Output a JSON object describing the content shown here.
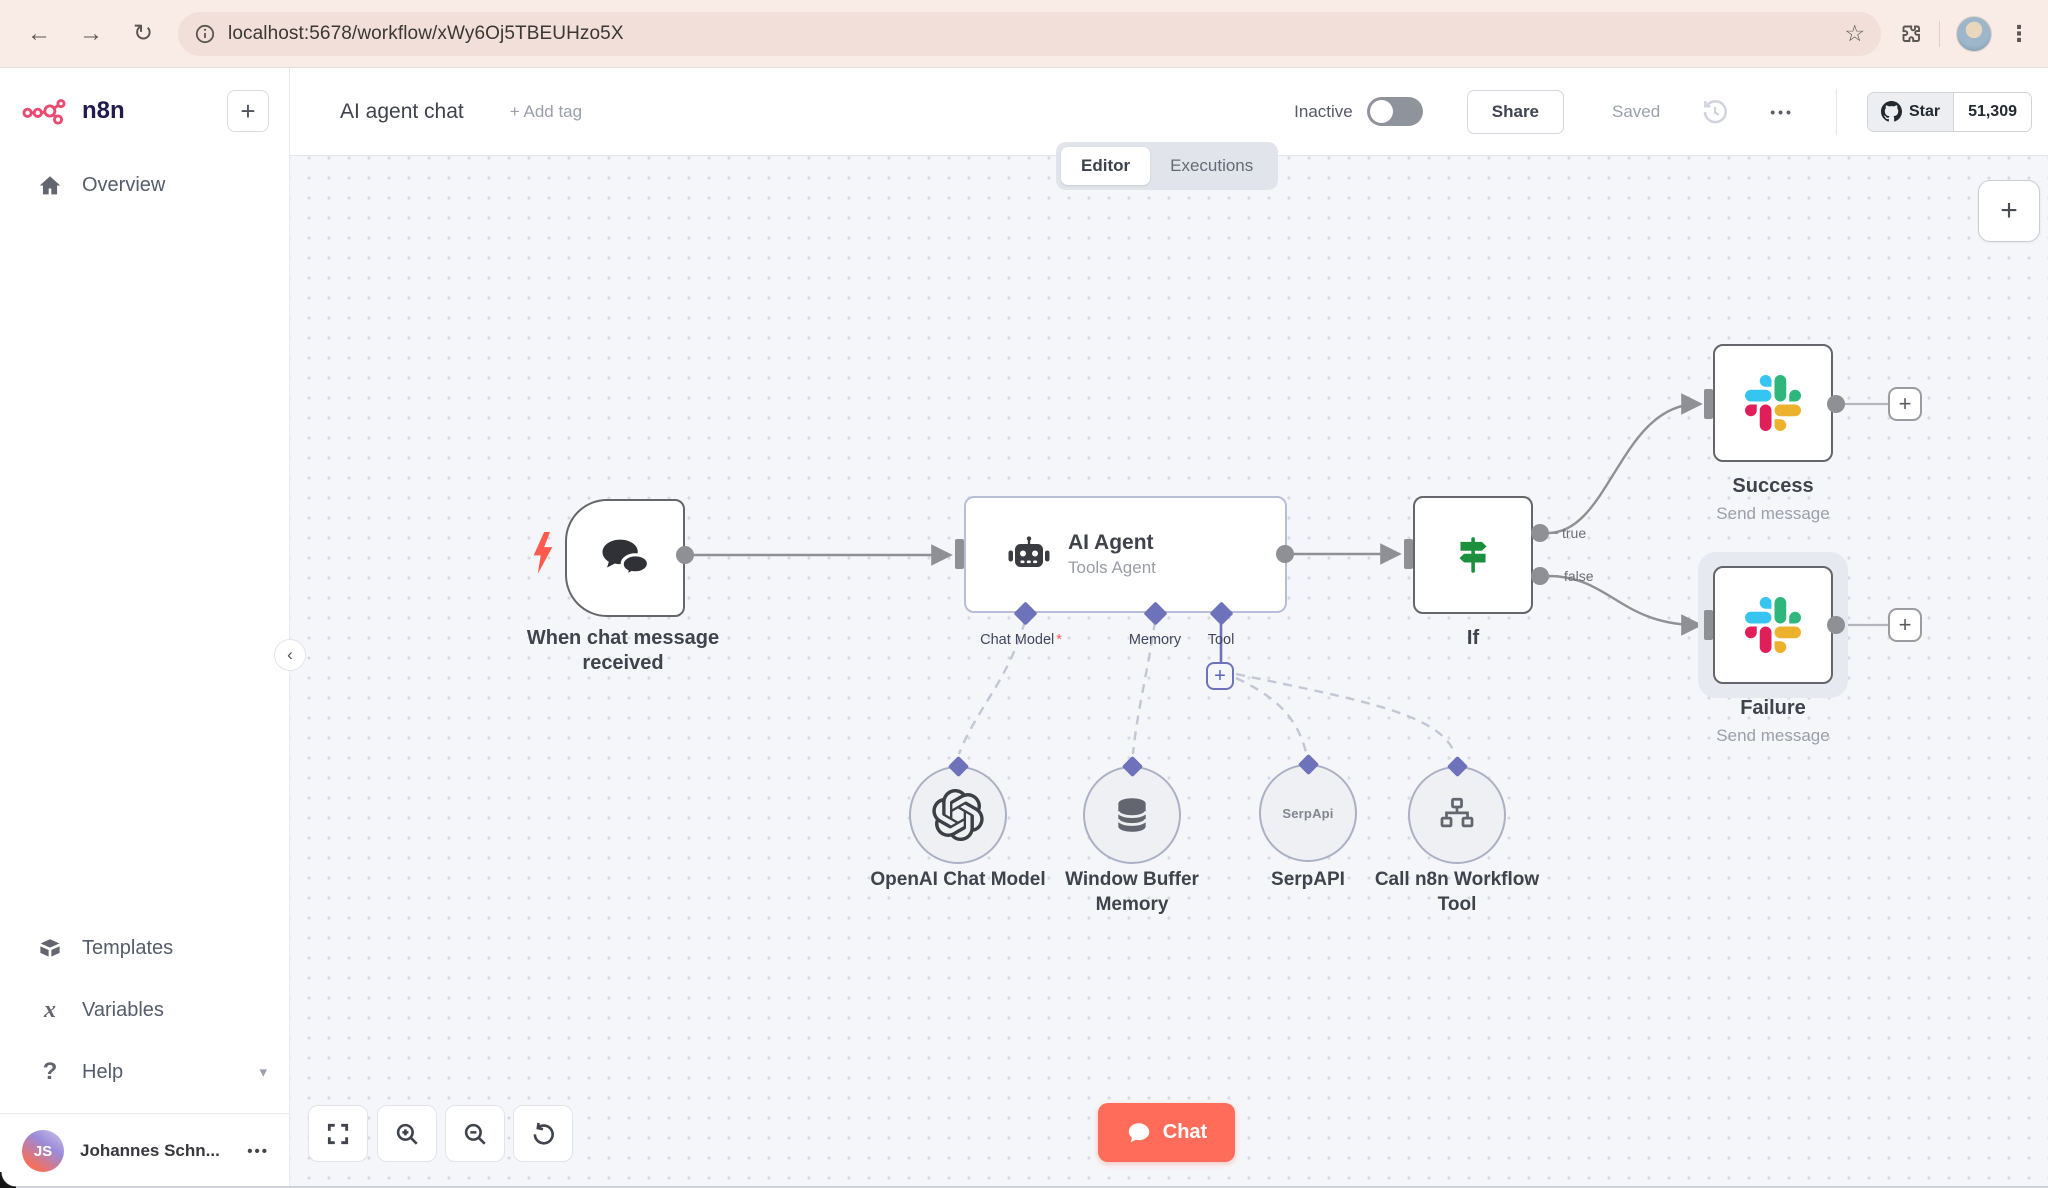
{
  "browser": {
    "url": "localhost:5678/workflow/xWy6Oj5TBEUHzo5X",
    "icons": [
      "back-icon",
      "forward-icon",
      "reload-icon",
      "site-info-icon",
      "bookmark-star-icon",
      "extensions-icon",
      "profile-avatar",
      "browser-menu-icon"
    ]
  },
  "sidebar": {
    "brand": "n8n",
    "new_workflow_button": "+",
    "items_top": [
      {
        "label": "Overview",
        "icon": "home-icon"
      }
    ],
    "items_bottom": [
      {
        "label": "Templates",
        "icon": "package-icon"
      },
      {
        "label": "Variables",
        "icon": "variable-x-icon"
      },
      {
        "label": "Help",
        "icon": "question-icon",
        "chevron": "down"
      }
    ],
    "user": {
      "initials": "JS",
      "name": "Johannes Schn...",
      "menu": "..."
    }
  },
  "header": {
    "title": "AI agent chat",
    "add_tag": "+ Add tag",
    "status_label": "Inactive",
    "share_label": "Share",
    "saved_label": "Saved",
    "menu": "...",
    "github": {
      "label": "Star",
      "count": "51,309"
    }
  },
  "tabs": {
    "editor": "Editor",
    "executions": "Executions"
  },
  "canvas": {
    "nodes": {
      "trigger": {
        "label": "When chat message received",
        "icon": "chat-bubbles-icon"
      },
      "agent": {
        "title": "AI Agent",
        "subtitle": "Tools Agent",
        "icon": "robot-icon",
        "connectors": [
          {
            "label": "Chat Model",
            "required": "*"
          },
          {
            "label": "Memory",
            "required": ""
          },
          {
            "label": "Tool",
            "required": ""
          }
        ]
      },
      "if": {
        "label": "If",
        "icon": "signpost-icon",
        "outputs": [
          "true",
          "false"
        ]
      },
      "success": {
        "label": "Success",
        "subtitle": "Send message",
        "icon": "slack-icon"
      },
      "failure": {
        "label": "Failure",
        "subtitle": "Send message",
        "icon": "slack-icon",
        "selected": true
      },
      "subnodes": [
        {
          "label": "OpenAI Chat Model",
          "icon": "openai-icon"
        },
        {
          "label": "Window Buffer Memory",
          "icon": "database-icon"
        },
        {
          "label": "SerpAPI",
          "icon": "serpapi-badge",
          "badge": "SerpApi"
        },
        {
          "label": "Call n8n Workflow Tool",
          "icon": "sitemap-icon"
        }
      ]
    },
    "controls": [
      "fit-view",
      "zoom-in",
      "zoom-out",
      "reset-zoom"
    ],
    "chat_button": "Chat",
    "plus": "+"
  },
  "colors": {
    "accent": "#ff6d5a",
    "brand_pink": "#ea4b71",
    "if_green": "#1b8f3e",
    "connector_purple": "#6d72ba",
    "slack": [
      "#36C5F0",
      "#2EB67D",
      "#E01E5A",
      "#ECB22E"
    ],
    "canvas_bg": "#f5f6f9",
    "chrome_bg": "#f9ebe5"
  }
}
